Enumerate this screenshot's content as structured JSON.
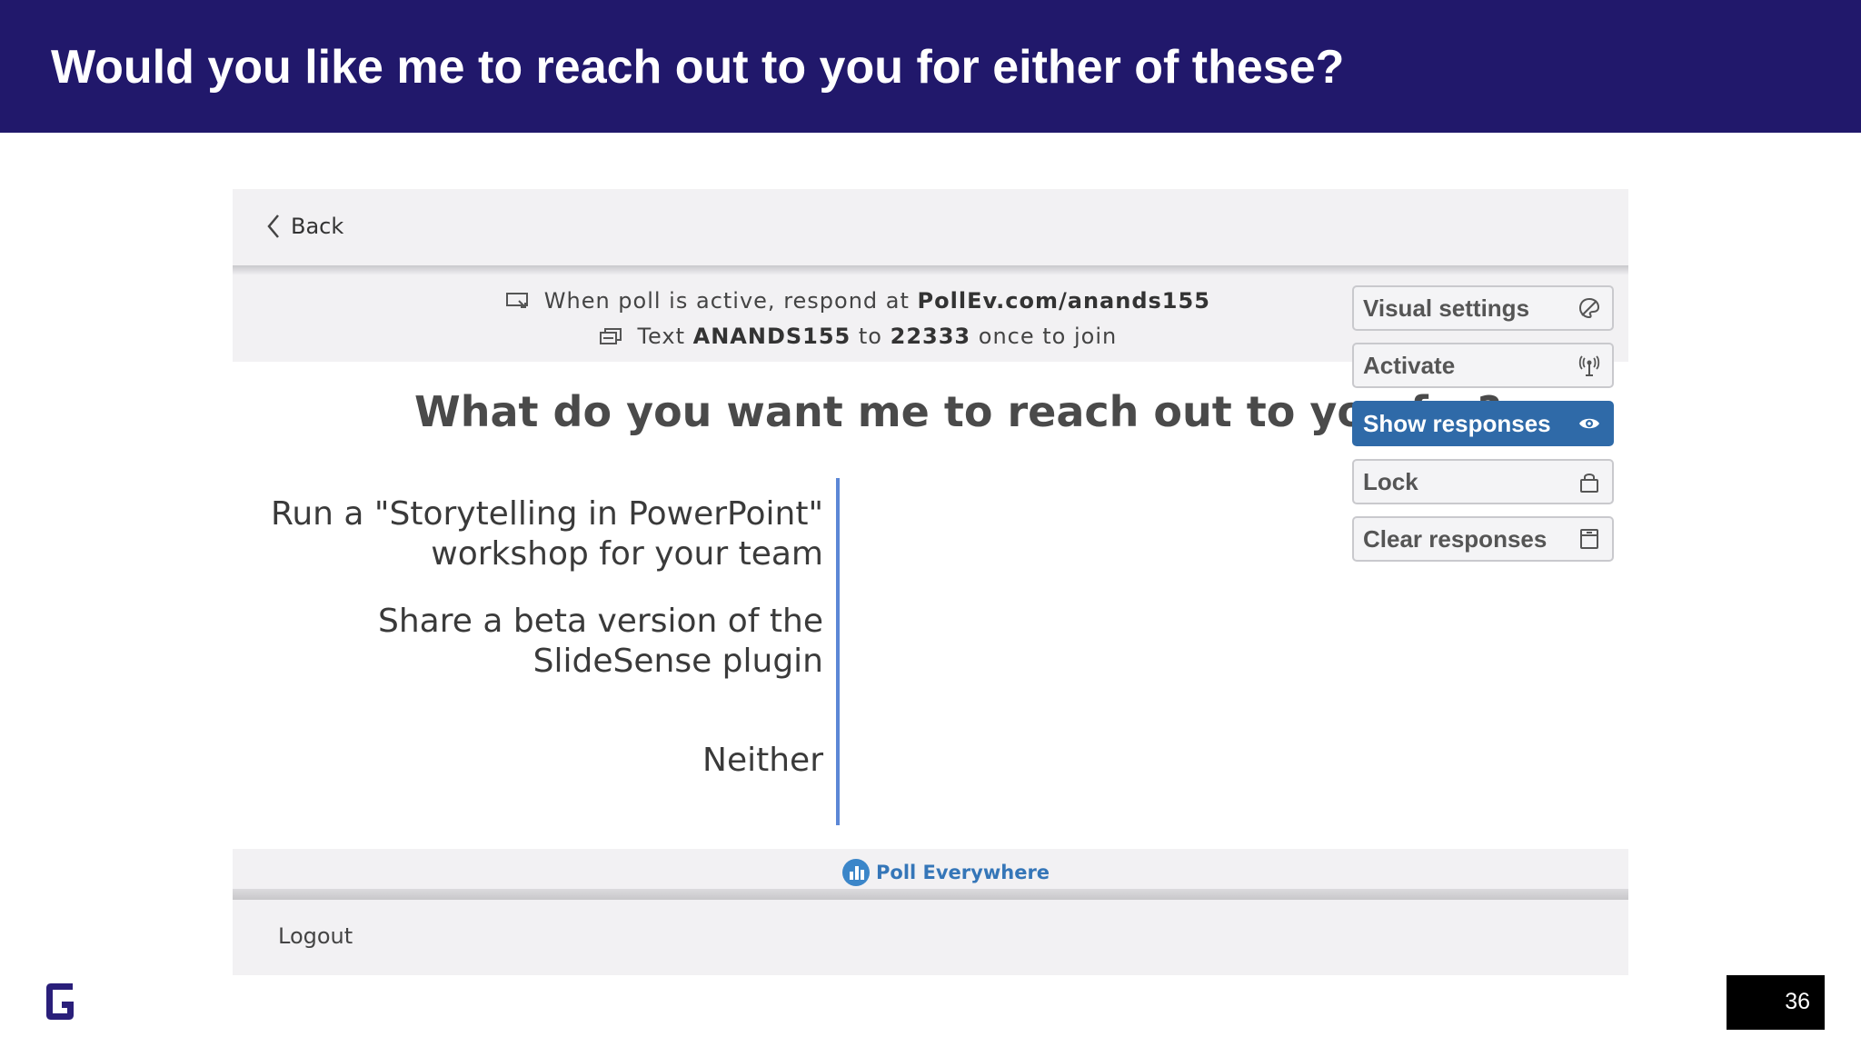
{
  "slide": {
    "title": "Would you like me to reach out to you for either of these?",
    "page_number": "36"
  },
  "app": {
    "back_label": "Back",
    "info_line1_prefix": "When poll is active, respond at",
    "info_line1_url": "PollEv.com/anands155",
    "info_line2_prefix": "Text",
    "info_line2_code": "ANANDS155",
    "info_line2_mid": "to",
    "info_line2_number": "22333",
    "info_line2_suffix": "once to join",
    "question": "What do you want me to reach out to you for?",
    "options": [
      {
        "line1": "Run a \"Storytelling in PowerPoint\"",
        "line2": "workshop for your team"
      },
      {
        "line1": "Share a beta version of the",
        "line2": "SlideSense plugin"
      },
      {
        "line1": "Neither",
        "line2": ""
      }
    ],
    "brand": "Poll Everywhere",
    "logout_label": "Logout"
  },
  "panel": {
    "visual_settings": "Visual settings",
    "activate": "Activate",
    "show_responses": "Show responses",
    "lock": "Lock",
    "clear_responses": "Clear responses"
  },
  "colors": {
    "title_bar": "#21186b",
    "accent_blue": "#2f6aa8",
    "axis_blue": "#5c87d6"
  }
}
